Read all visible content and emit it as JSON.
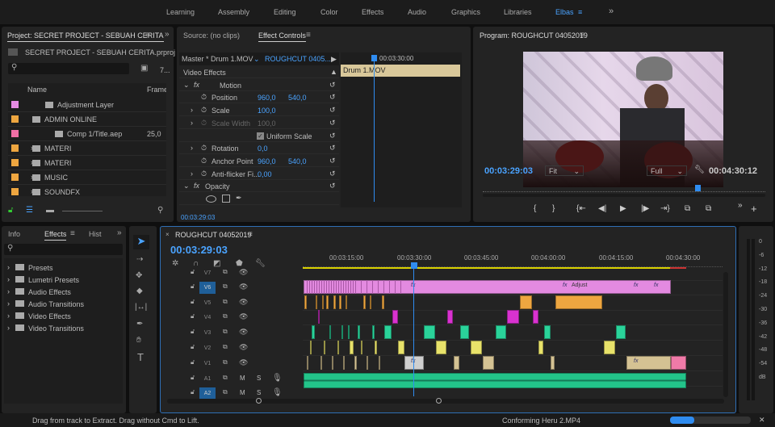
{
  "workspaces": {
    "tabs": [
      "Learning",
      "Assembly",
      "Editing",
      "Color",
      "Effects",
      "Audio",
      "Graphics",
      "Libraries",
      "Elbas"
    ],
    "active": "Elbas",
    "more": "»"
  },
  "project": {
    "title": "Project: SECRET PROJECT - SEBUAH CERITA",
    "file": "SECRET PROJECT - SEBUAH CERITA.prproj",
    "item_count": "7...",
    "col_name": "Name",
    "col_frame": "Frame",
    "items": [
      {
        "name": "Adjustment Layer",
        "color": "#e58be3",
        "frame": ""
      },
      {
        "name": "ADMIN ONLINE",
        "color": "#eea640",
        "frame": ""
      },
      {
        "name": "Comp 1/Title.aep",
        "color": "#f06fa5",
        "frame": "25,0"
      },
      {
        "name": "MATERI",
        "color": "#eea640",
        "frame": ""
      },
      {
        "name": "MATERI",
        "color": "#eea640",
        "frame": ""
      },
      {
        "name": "MUSIC",
        "color": "#eea640",
        "frame": ""
      },
      {
        "name": "SOUNDFX",
        "color": "#eea640",
        "frame": ""
      }
    ]
  },
  "source": {
    "tab_source": "Source: (no clips)",
    "tab_effect": "Effect Controls",
    "master": "Master * Drum 1.MOV",
    "sequence": "ROUGHCUT 0405...",
    "ruler_time": "00:03:30:00",
    "clip": "Drum 1.MOV",
    "section": "Video Effects",
    "timecode": "00:03:29:03",
    "motion": "Motion",
    "position": {
      "label": "Position",
      "x": "960,0",
      "y": "540,0"
    },
    "scale": {
      "label": "Scale",
      "v": "100,0"
    },
    "scale_width": {
      "label": "Scale Width",
      "v": "100,0"
    },
    "uniform": "Uniform Scale",
    "rotation": {
      "label": "Rotation",
      "v": "0,0"
    },
    "anchor": {
      "label": "Anchor Point",
      "x": "960,0",
      "y": "540,0"
    },
    "antiflicker": {
      "label": "Anti-flicker Fi...",
      "v": "0,00"
    },
    "opacity": "Opacity"
  },
  "program": {
    "title": "Program: ROUGHCUT 04052019",
    "timecode": "00:03:29:03",
    "fit": "Fit",
    "quality": "Full",
    "duration": "00:04:30:12"
  },
  "effects": {
    "tab_info": "Info",
    "tab_effects": "Effects",
    "tab_history": "Hist",
    "items": [
      "Presets",
      "Lumetri Presets",
      "Audio Effects",
      "Audio Transitions",
      "Video Effects",
      "Video Transitions"
    ]
  },
  "timeline": {
    "title": "ROUGHCUT 04052019",
    "timecode": "00:03:29:03",
    "ruler": [
      "00:03:15:00",
      "00:03:30:00",
      "00:03:45:00",
      "00:04:00:00",
      "00:04:15:00",
      "00:04:30:00"
    ],
    "tracks": [
      "V7",
      "V6",
      "V5",
      "V4",
      "V3",
      "V2",
      "V1",
      "A1",
      "A2"
    ],
    "adjust_label": "Adjust",
    "fx": "fx",
    "m": "M",
    "s": "S"
  },
  "meters": {
    "labels": [
      "0",
      "-6",
      "-12",
      "-18",
      "-24",
      "-30",
      "-36",
      "-42",
      "-48",
      "-54",
      "dB"
    ]
  },
  "status": {
    "hint": "Drag from track to Extract. Drag without Cmd to Lift.",
    "task": "Conforming Heru 2.MP4",
    "progress": 0.3
  }
}
